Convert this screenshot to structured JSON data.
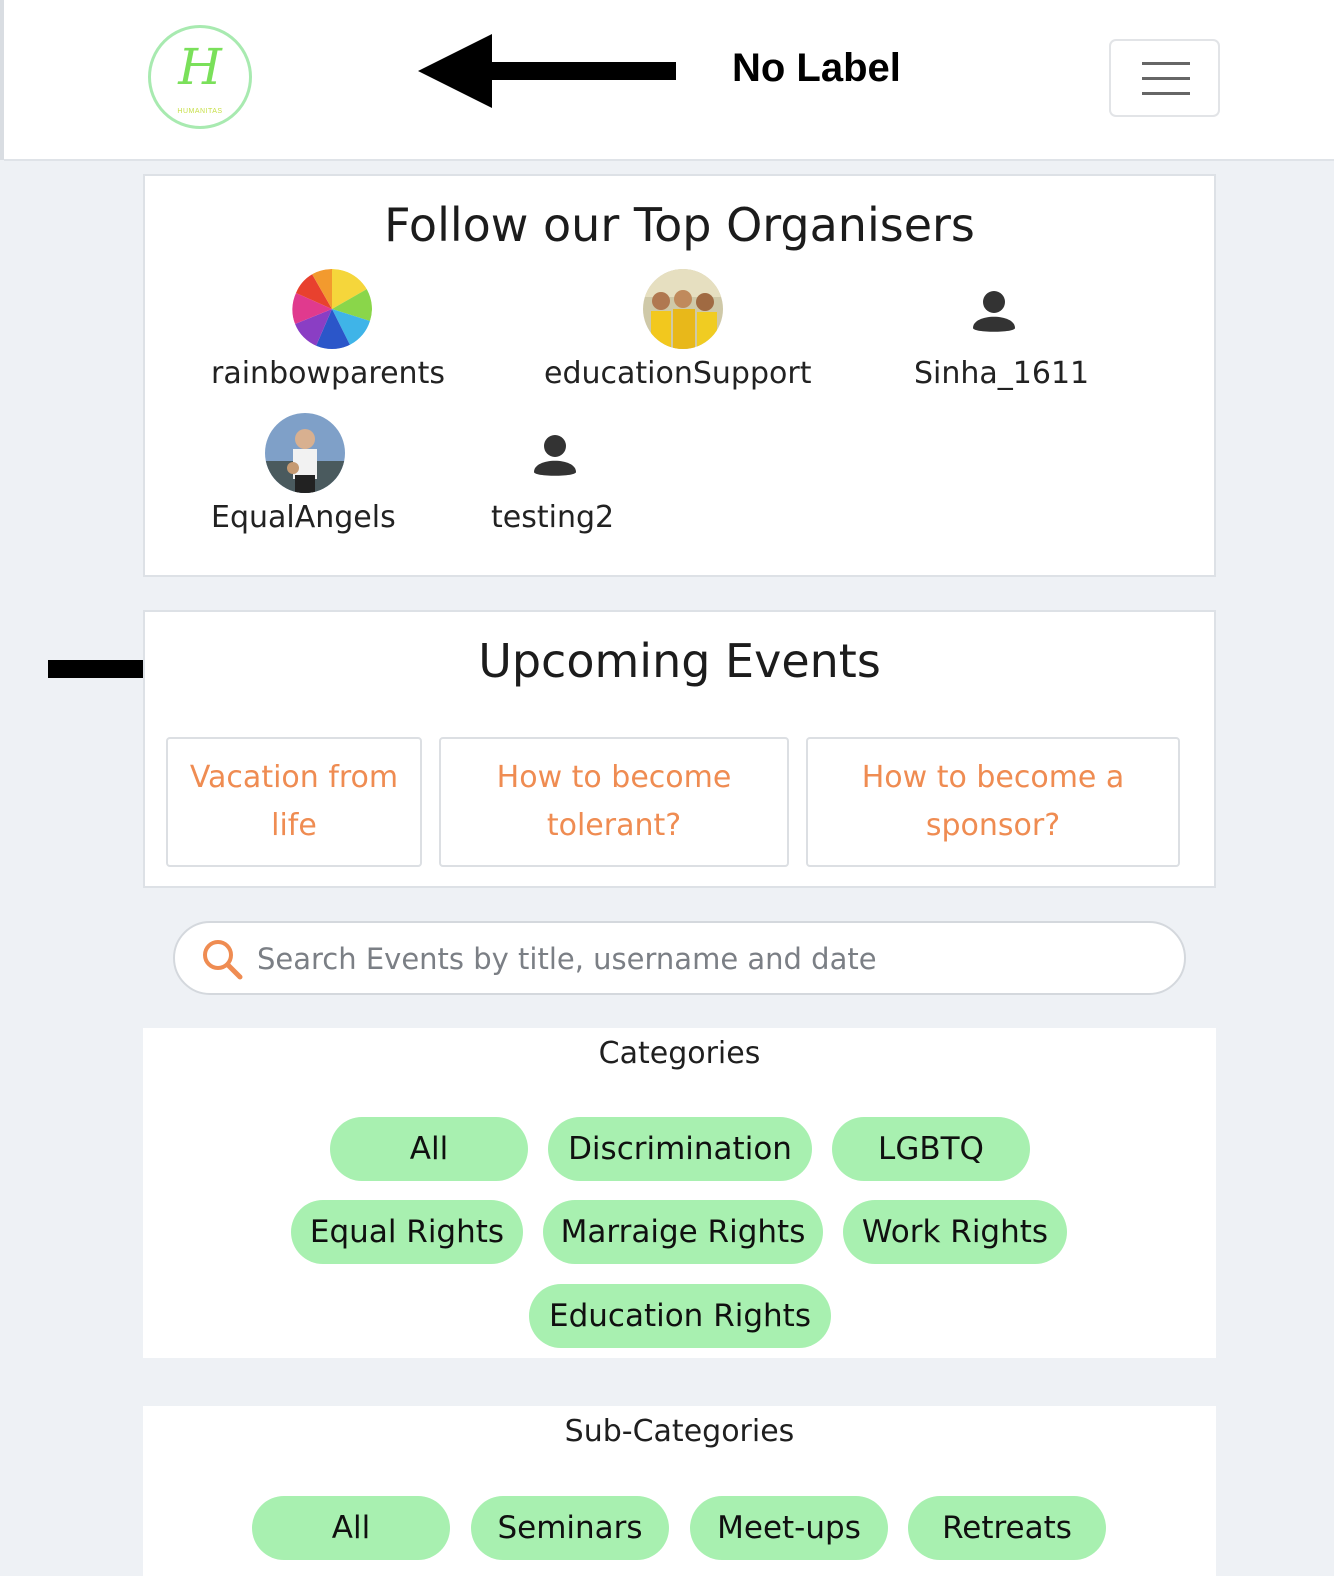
{
  "annotation": {
    "label": "No Label"
  },
  "logo": {
    "letter": "H",
    "text": "HUMANITAS"
  },
  "colors": {
    "pill": "#a8f0b0",
    "event_link": "#ef8c52",
    "search_icon": "#ef8c52"
  },
  "organisers": {
    "title": "Follow our Top Organisers",
    "items": [
      {
        "name": "rainbowparents",
        "avatar": "rainbow-image"
      },
      {
        "name": "educationSupport",
        "avatar": "group-photo"
      },
      {
        "name": "Sinha_1611",
        "avatar": "person-icon"
      },
      {
        "name": "EqualAngels",
        "avatar": "person-photo"
      },
      {
        "name": "testing2",
        "avatar": "person-icon"
      }
    ]
  },
  "events": {
    "title": "Upcoming Events",
    "items": [
      "Vacation from life",
      "How to become tolerant?",
      "How to become a sponsor?"
    ]
  },
  "search": {
    "placeholder": "Search Events by title, username and date",
    "icon": "search-icon"
  },
  "categories": {
    "title": "Categories",
    "items": [
      "All",
      "Discrimination",
      "LGBTQ",
      "Equal Rights",
      "Marraige Rights",
      "Work Rights",
      "Education Rights"
    ]
  },
  "subcategories": {
    "title": "Sub-Categories",
    "items": [
      "All",
      "Seminars",
      "Meet-ups",
      "Retreats"
    ]
  }
}
